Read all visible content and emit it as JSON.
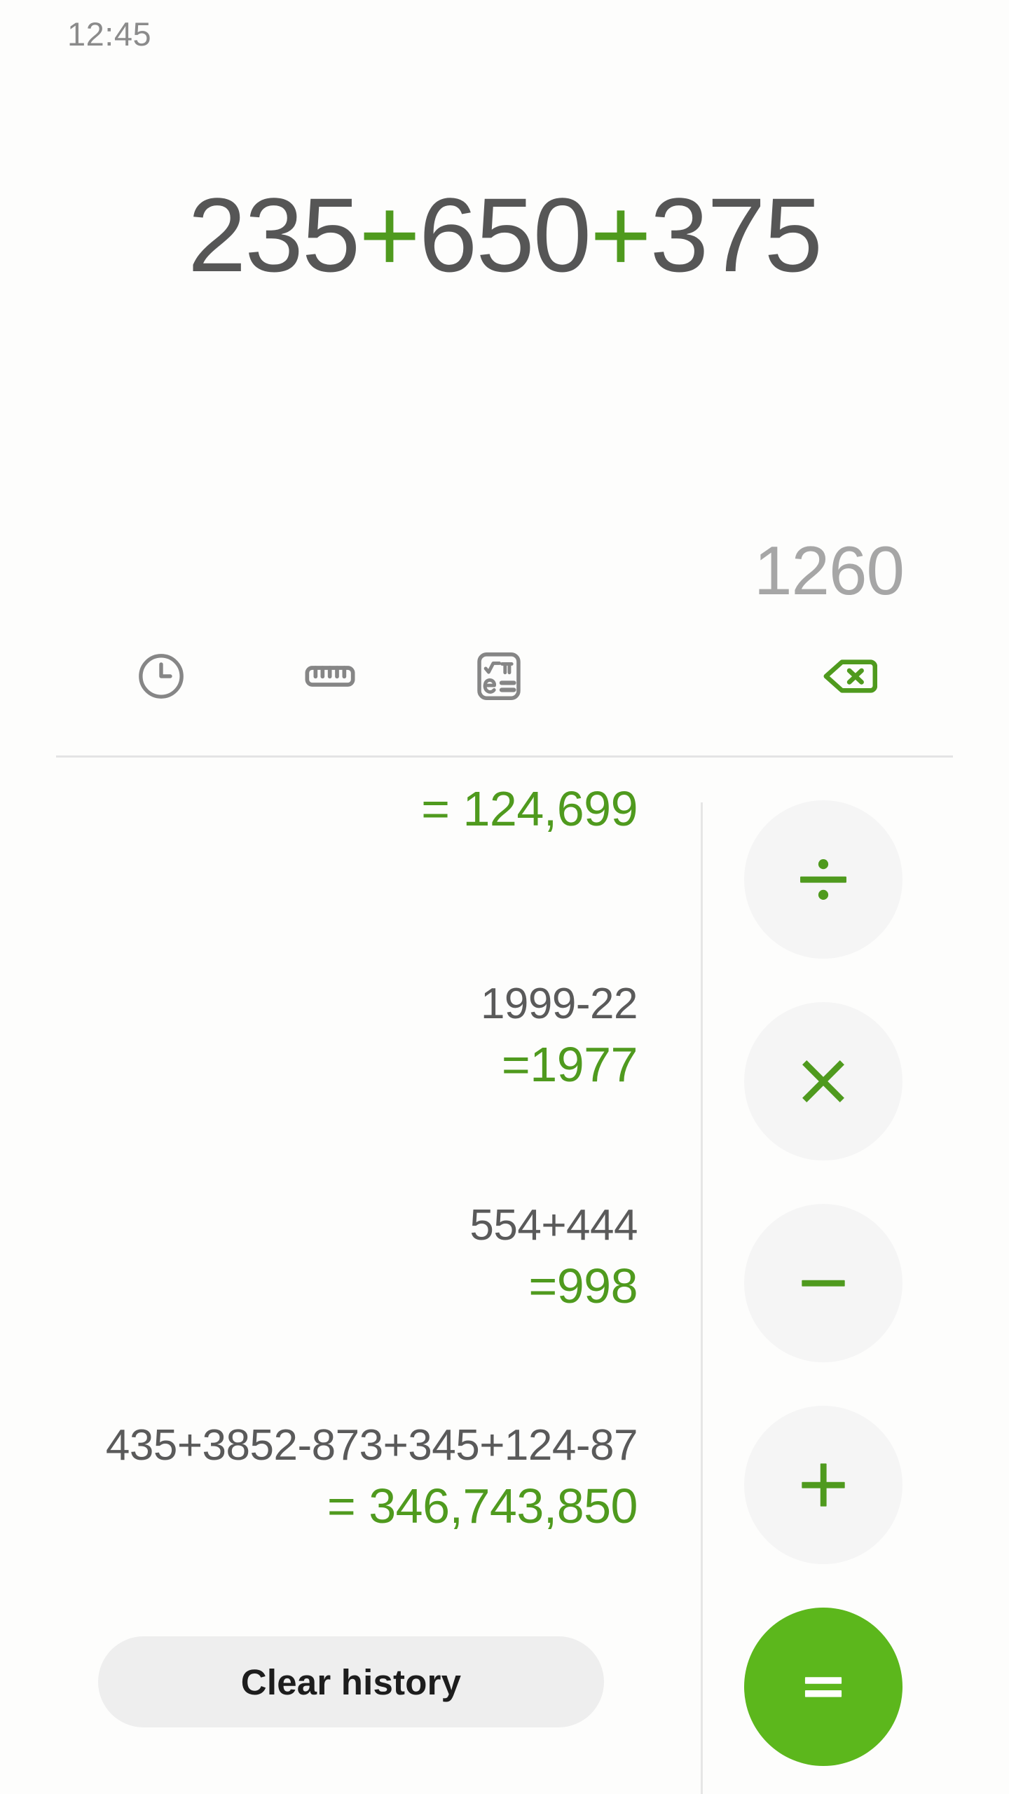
{
  "status_bar": {
    "time": "12:45"
  },
  "display": {
    "expression_parts": [
      {
        "text": "235",
        "type": "number"
      },
      {
        "text": "+",
        "type": "operator"
      },
      {
        "text": "650",
        "type": "number"
      },
      {
        "text": "+",
        "type": "operator"
      },
      {
        "text": "375",
        "type": "number"
      }
    ],
    "expression_text": "235+650+375",
    "preview_result": "1260"
  },
  "toolbar": {
    "items": [
      {
        "icon": "clock-icon",
        "name": "history"
      },
      {
        "icon": "ruler-icon",
        "name": "unit-converter"
      },
      {
        "icon": "scientific-icon",
        "name": "scientific-mode"
      },
      {
        "icon": "backspace-icon",
        "name": "backspace"
      }
    ]
  },
  "history": {
    "entries": [
      {
        "expression": "",
        "result": "= 124,699"
      },
      {
        "expression": "1999-22",
        "result": "=1977"
      },
      {
        "expression": "554+444",
        "result": "=998"
      },
      {
        "expression": "435+3852-873+345+124-87",
        "result": "= 346,743,850"
      }
    ],
    "clear_button_label": "Clear history"
  },
  "keypad": {
    "keys": [
      {
        "label": "÷",
        "name": "divide"
      },
      {
        "label": "×",
        "name": "multiply"
      },
      {
        "label": "−",
        "name": "subtract"
      },
      {
        "label": "+",
        "name": "add"
      },
      {
        "label": "=",
        "name": "equals"
      }
    ]
  },
  "colors": {
    "accent_green": "#5cb71c",
    "operator_green": "#4f9a1e",
    "text_dark": "#565656",
    "text_muted": "#a6a6a6",
    "key_bg": "#f5f5f5",
    "divider": "#e4e4e4",
    "background": "#fdfdfc"
  }
}
